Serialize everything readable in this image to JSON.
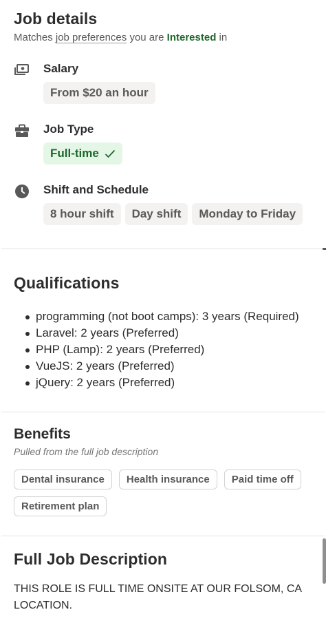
{
  "job_details": {
    "title": "Job details",
    "matches_prefix": "Matches",
    "preferences_link": "job preferences",
    "you_are": "you are",
    "interested": "Interested",
    "in": "in",
    "salary": {
      "icon": "money-icon",
      "title": "Salary",
      "value": "From $20 an hour"
    },
    "job_type": {
      "icon": "briefcase-icon",
      "title": "Job Type",
      "value": "Full-time",
      "matched": true
    },
    "schedule": {
      "icon": "clock-icon",
      "title": "Shift and Schedule",
      "values": [
        "8 hour shift",
        "Day shift",
        "Monday to Friday"
      ]
    }
  },
  "qualifications": {
    "title": "Qualifications",
    "items": [
      "programming (not boot camps): 3 years (Required)",
      "Laravel: 2 years (Preferred)",
      "PHP (Lamp): 2 years (Preferred)",
      "VueJS: 2 years (Preferred)",
      "jQuery: 2 years (Preferred)"
    ]
  },
  "benefits": {
    "title": "Benefits",
    "subtitle": "Pulled from the full job description",
    "items": [
      "Dental insurance",
      "Health insurance",
      "Paid time off",
      "Retirement plan"
    ]
  },
  "full_description": {
    "title": "Full Job Description",
    "text": "THIS ROLE IS FULL TIME ONSITE AT OUR FOLSOM, CA LOCATION."
  },
  "colors": {
    "interested_green": "#1f662c",
    "matched_pill_bg": "#e4f7e6"
  }
}
